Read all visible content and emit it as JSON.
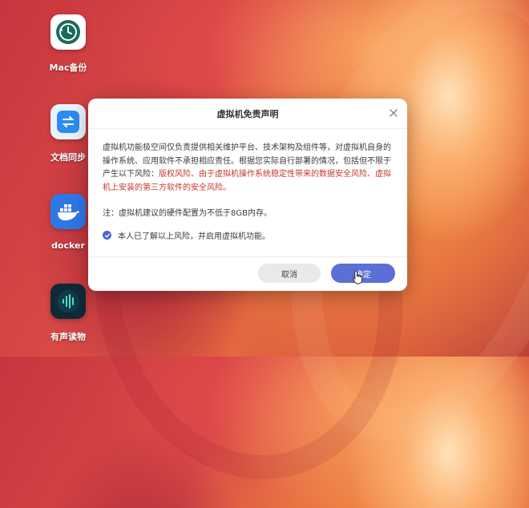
{
  "desktop": {
    "icons": [
      {
        "label": "Mac备份",
        "icon": "time-machine-icon"
      },
      {
        "label": "文档同步",
        "icon": "sync-arrows-icon"
      },
      {
        "label": "docker",
        "icon": "docker-whale-icon"
      },
      {
        "label": "有声读物",
        "icon": "audio-waveform-icon"
      }
    ]
  },
  "dialog": {
    "title": "虚拟机免责声明",
    "paragraph_normal": "虚拟机功能极空间仅负责提供相关维护平台、技术架构及组件等，对虚拟机自身的操作系统、应用软件不承担相应责任。根据您实际自行部署的情况，包括但不限于产生以下风险：",
    "paragraph_risk": "版权风险、由于虚拟机操作系统稳定性带来的数据安全风险、虚拟机上安装的第三方软件的安全风险。",
    "note": "注：虚拟机建议的硬件配置为不低于8GB内存。",
    "agree_label": "本人已了解以上风险，并启用虚拟机功能。",
    "agree_checked": true,
    "cancel_label": "取消",
    "ok_label": "确定"
  },
  "colors": {
    "accent": "#5b6fd6",
    "risk_text": "#c0392b",
    "checkbox": "#4a63d6"
  }
}
